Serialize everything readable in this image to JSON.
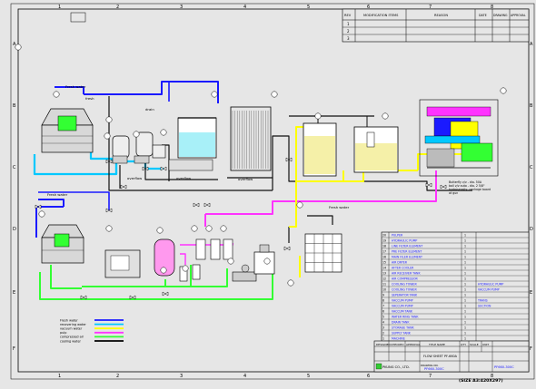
{
  "grid": {
    "cols": [
      "1",
      "2",
      "3",
      "4",
      "5",
      "6",
      "7",
      "8"
    ],
    "rows": [
      "A",
      "B",
      "C",
      "D",
      "E",
      "F"
    ]
  },
  "revision_block": {
    "headers": [
      "REV",
      "MODIFICATION ITEMS",
      "REASON",
      "DATE",
      "DRAWING",
      "APPROVAL"
    ],
    "rows": [
      "1",
      "2",
      "3"
    ]
  },
  "legend": {
    "items": [
      {
        "label": "Fresh water",
        "color": "#1a1aff"
      },
      {
        "label": "recovering water",
        "color": "#00c8ff"
      },
      {
        "label": "vacuum water",
        "color": "#ffff00"
      },
      {
        "label": "pulp",
        "color": "#ff33ff"
      },
      {
        "label": "compressed air",
        "color": "#33ff33"
      },
      {
        "label": "cooling water",
        "color": "#000000"
      }
    ]
  },
  "labels": {
    "fresh_water_1": "Fresh water",
    "fresh_water_2": "Fresh water",
    "fresh_water_3": "Fresh water",
    "overflow_1": "overflow",
    "overflow_2": "overflow",
    "overflow_3": "overflow",
    "drain": "drain",
    "fresh": "fresh",
    "note": "Butterfly v/v - dia. 50A ball v/v auto - dia. 2 5/8\" hydrosensity, package board at gun"
  },
  "parts": [
    {
      "no": "20",
      "name": "PULPER",
      "qty": "1",
      "remark": ""
    },
    {
      "no": "19",
      "name": "HYDRAULIC PUMP",
      "qty": "1",
      "remark": ""
    },
    {
      "no": "18",
      "name": "LINE FILTER ELEMENT",
      "qty": "1",
      "remark": ""
    },
    {
      "no": "17",
      "name": "PRE FILTER ELEMENT",
      "qty": "1",
      "remark": ""
    },
    {
      "no": "16",
      "name": "MAIN FILER ELEMENT",
      "qty": "1",
      "remark": ""
    },
    {
      "no": "15",
      "name": "AIR DRYER",
      "qty": "1",
      "remark": ""
    },
    {
      "no": "14",
      "name": "AFTER COOLER",
      "qty": "1",
      "remark": ""
    },
    {
      "no": "13",
      "name": "AIR RECEIVER TANK",
      "qty": "1",
      "remark": ""
    },
    {
      "no": "12",
      "name": "AIR COMPRESSOR",
      "qty": "1",
      "remark": ""
    },
    {
      "no": "11",
      "name": "COOLING TOWER",
      "qty": "1",
      "remark": "HYDRAULIC PUMP"
    },
    {
      "no": "10",
      "name": "COOLING TOWER",
      "qty": "1",
      "remark": "VACCUM PUMP"
    },
    {
      "no": "9",
      "name": "SEPERATOR TANK",
      "qty": "1",
      "remark": ""
    },
    {
      "no": "8",
      "name": "VACCUM PUMP",
      "qty": "1",
      "remark": "TRANS"
    },
    {
      "no": "7",
      "name": "VACCUM PUMP",
      "qty": "1",
      "remark": "SUCTION"
    },
    {
      "no": "6",
      "name": "VACCUM TANK",
      "qty": "1",
      "remark": ""
    },
    {
      "no": "5",
      "name": "WATER RING TANK",
      "qty": "1",
      "remark": ""
    },
    {
      "no": "4",
      "name": "DRAIN TANK",
      "qty": "1",
      "remark": ""
    },
    {
      "no": "3",
      "name": "STORAGE TANK",
      "qty": "1",
      "remark": ""
    },
    {
      "no": "2",
      "name": "SUPPLY TANK",
      "qty": "1",
      "remark": ""
    },
    {
      "no": "1",
      "name": "MACHINE",
      "qty": "1",
      "remark": ""
    }
  ],
  "title_block": {
    "parts_header": [
      "NO",
      "DESCRIPTION",
      "QTY",
      "REMARK"
    ],
    "designed": "DESIGNED",
    "checked": "CHECKED",
    "approval": "APPROVAL",
    "title_label": "TITLE NAME",
    "title": "FLOW SHEET PF-660A",
    "company": "PKUNG CO., LTD.",
    "drawing_no_label": "DRAWING NO.",
    "drawing_no": "PF660-300C",
    "drawing_no_2": "PF660-300C",
    "qty_label": "QTY",
    "scale_label": "SCALE",
    "unit_label": "UNIT"
  },
  "size_note": "(SIZE A3:420X297)"
}
